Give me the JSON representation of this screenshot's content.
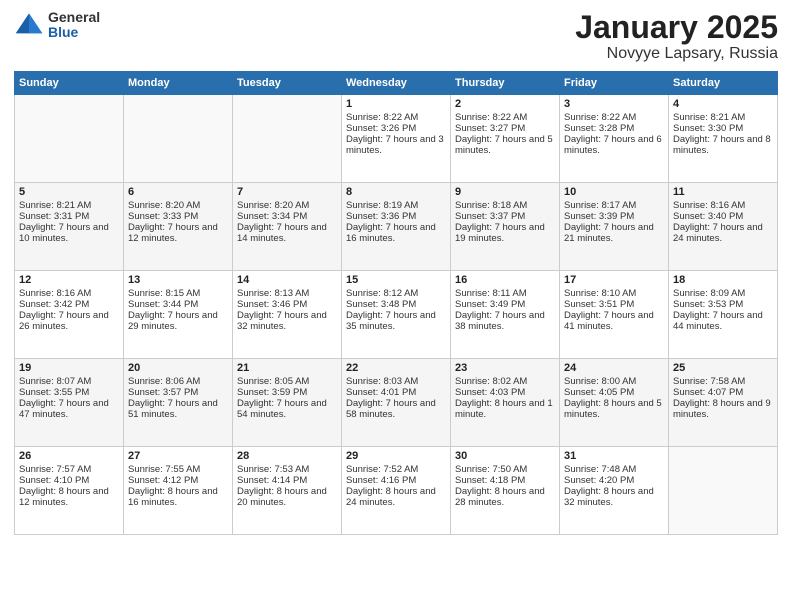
{
  "header": {
    "logo": {
      "general": "General",
      "blue": "Blue"
    },
    "title": "January 2025",
    "location": "Novyye Lapsary, Russia"
  },
  "weekdays": [
    "Sunday",
    "Monday",
    "Tuesday",
    "Wednesday",
    "Thursday",
    "Friday",
    "Saturday"
  ],
  "weeks": [
    [
      {
        "day": "",
        "info": ""
      },
      {
        "day": "",
        "info": ""
      },
      {
        "day": "",
        "info": ""
      },
      {
        "day": "1",
        "info": "Sunrise: 8:22 AM\nSunset: 3:26 PM\nDaylight: 7 hours and 3 minutes."
      },
      {
        "day": "2",
        "info": "Sunrise: 8:22 AM\nSunset: 3:27 PM\nDaylight: 7 hours and 5 minutes."
      },
      {
        "day": "3",
        "info": "Sunrise: 8:22 AM\nSunset: 3:28 PM\nDaylight: 7 hours and 6 minutes."
      },
      {
        "day": "4",
        "info": "Sunrise: 8:21 AM\nSunset: 3:30 PM\nDaylight: 7 hours and 8 minutes."
      }
    ],
    [
      {
        "day": "5",
        "info": "Sunrise: 8:21 AM\nSunset: 3:31 PM\nDaylight: 7 hours and 10 minutes."
      },
      {
        "day": "6",
        "info": "Sunrise: 8:20 AM\nSunset: 3:33 PM\nDaylight: 7 hours and 12 minutes."
      },
      {
        "day": "7",
        "info": "Sunrise: 8:20 AM\nSunset: 3:34 PM\nDaylight: 7 hours and 14 minutes."
      },
      {
        "day": "8",
        "info": "Sunrise: 8:19 AM\nSunset: 3:36 PM\nDaylight: 7 hours and 16 minutes."
      },
      {
        "day": "9",
        "info": "Sunrise: 8:18 AM\nSunset: 3:37 PM\nDaylight: 7 hours and 19 minutes."
      },
      {
        "day": "10",
        "info": "Sunrise: 8:17 AM\nSunset: 3:39 PM\nDaylight: 7 hours and 21 minutes."
      },
      {
        "day": "11",
        "info": "Sunrise: 8:16 AM\nSunset: 3:40 PM\nDaylight: 7 hours and 24 minutes."
      }
    ],
    [
      {
        "day": "12",
        "info": "Sunrise: 8:16 AM\nSunset: 3:42 PM\nDaylight: 7 hours and 26 minutes."
      },
      {
        "day": "13",
        "info": "Sunrise: 8:15 AM\nSunset: 3:44 PM\nDaylight: 7 hours and 29 minutes."
      },
      {
        "day": "14",
        "info": "Sunrise: 8:13 AM\nSunset: 3:46 PM\nDaylight: 7 hours and 32 minutes."
      },
      {
        "day": "15",
        "info": "Sunrise: 8:12 AM\nSunset: 3:48 PM\nDaylight: 7 hours and 35 minutes."
      },
      {
        "day": "16",
        "info": "Sunrise: 8:11 AM\nSunset: 3:49 PM\nDaylight: 7 hours and 38 minutes."
      },
      {
        "day": "17",
        "info": "Sunrise: 8:10 AM\nSunset: 3:51 PM\nDaylight: 7 hours and 41 minutes."
      },
      {
        "day": "18",
        "info": "Sunrise: 8:09 AM\nSunset: 3:53 PM\nDaylight: 7 hours and 44 minutes."
      }
    ],
    [
      {
        "day": "19",
        "info": "Sunrise: 8:07 AM\nSunset: 3:55 PM\nDaylight: 7 hours and 47 minutes."
      },
      {
        "day": "20",
        "info": "Sunrise: 8:06 AM\nSunset: 3:57 PM\nDaylight: 7 hours and 51 minutes."
      },
      {
        "day": "21",
        "info": "Sunrise: 8:05 AM\nSunset: 3:59 PM\nDaylight: 7 hours and 54 minutes."
      },
      {
        "day": "22",
        "info": "Sunrise: 8:03 AM\nSunset: 4:01 PM\nDaylight: 7 hours and 58 minutes."
      },
      {
        "day": "23",
        "info": "Sunrise: 8:02 AM\nSunset: 4:03 PM\nDaylight: 8 hours and 1 minute."
      },
      {
        "day": "24",
        "info": "Sunrise: 8:00 AM\nSunset: 4:05 PM\nDaylight: 8 hours and 5 minutes."
      },
      {
        "day": "25",
        "info": "Sunrise: 7:58 AM\nSunset: 4:07 PM\nDaylight: 8 hours and 9 minutes."
      }
    ],
    [
      {
        "day": "26",
        "info": "Sunrise: 7:57 AM\nSunset: 4:10 PM\nDaylight: 8 hours and 12 minutes."
      },
      {
        "day": "27",
        "info": "Sunrise: 7:55 AM\nSunset: 4:12 PM\nDaylight: 8 hours and 16 minutes."
      },
      {
        "day": "28",
        "info": "Sunrise: 7:53 AM\nSunset: 4:14 PM\nDaylight: 8 hours and 20 minutes."
      },
      {
        "day": "29",
        "info": "Sunrise: 7:52 AM\nSunset: 4:16 PM\nDaylight: 8 hours and 24 minutes."
      },
      {
        "day": "30",
        "info": "Sunrise: 7:50 AM\nSunset: 4:18 PM\nDaylight: 8 hours and 28 minutes."
      },
      {
        "day": "31",
        "info": "Sunrise: 7:48 AM\nSunset: 4:20 PM\nDaylight: 8 hours and 32 minutes."
      },
      {
        "day": "",
        "info": ""
      }
    ]
  ]
}
